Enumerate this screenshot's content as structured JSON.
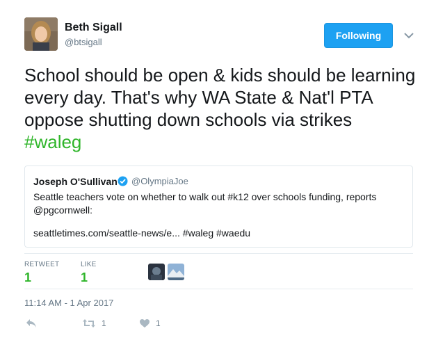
{
  "author": {
    "name": "Beth Sigall",
    "handle": "@btsigall"
  },
  "follow_button": {
    "label": "Following",
    "color": "#1da1f2"
  },
  "tweet": {
    "text": "School should be open & kids should be learning every day. That's why WA State & Nat'l PTA oppose shutting down schools via strikes",
    "hashtag": "#waleg"
  },
  "quoted": {
    "name": "Joseph O'Sullivan",
    "handle": "@OlympiaJoe",
    "text": "Seattle teachers vote on whether to walk out #k12 over schools funding, reports @pgcornwell:",
    "link": "seattletimes.com/seattle-news/e... #waleg #waedu"
  },
  "stats": {
    "retweet_label": "RETWEET",
    "retweet_count": "1",
    "like_label": "LIKE",
    "like_count": "1"
  },
  "timestamp": "11:14 AM - 1 Apr 2017",
  "actions": {
    "retweet_count": "1",
    "like_count": "1"
  },
  "icons": [
    "reply-icon",
    "retweet-icon",
    "heart-icon",
    "chevron-down-icon",
    "verified-icon"
  ],
  "colors": {
    "accent_green": "#2fb52a",
    "accent_blue": "#1da1f2",
    "muted": "#657786"
  }
}
